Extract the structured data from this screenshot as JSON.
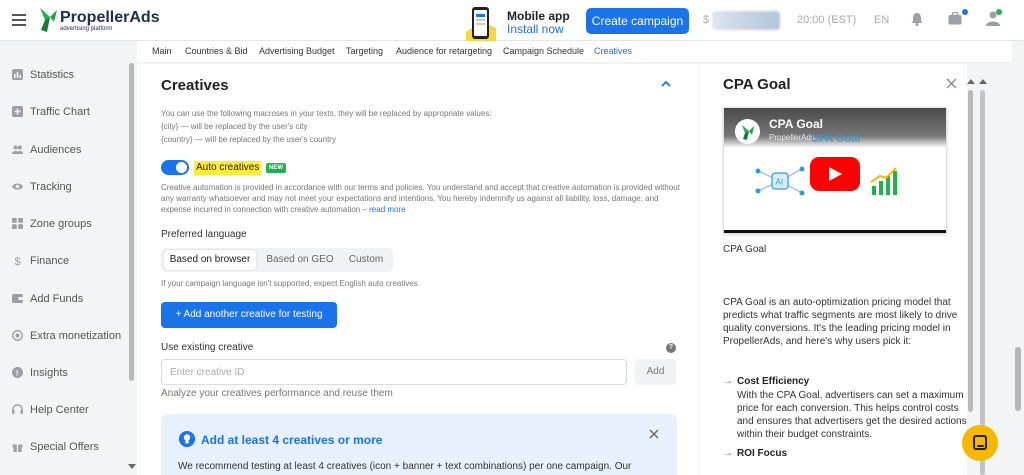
{
  "header": {
    "logo_text": "PropellerAds",
    "logo_tagline": "advertising platform",
    "mobile_app_title": "Mobile app",
    "mobile_app_link": "Install now",
    "create_campaign": "Create campaign",
    "balance_prefix": "$",
    "time": "20:00 (EST)",
    "language": "EN"
  },
  "sidebar": {
    "items": [
      {
        "label": "Statistics",
        "icon": "statistics-icon"
      },
      {
        "label": "Traffic Chart",
        "icon": "traffic-chart-icon"
      },
      {
        "label": "Audiences",
        "icon": "audiences-icon"
      },
      {
        "label": "Tracking",
        "icon": "tracking-icon"
      },
      {
        "label": "Zone groups",
        "icon": "zone-groups-icon"
      },
      {
        "label": "Finance",
        "icon": "dollar-icon"
      },
      {
        "label": "Add Funds",
        "icon": "wallet-icon"
      },
      {
        "label": "Extra monetization",
        "icon": "extra-monetization-icon"
      },
      {
        "label": "Insights",
        "icon": "lightbulb-icon"
      },
      {
        "label": "Help Center",
        "icon": "headset-icon"
      },
      {
        "label": "Special Offers",
        "icon": "gift-icon"
      }
    ]
  },
  "tabs": [
    "Main",
    "Countries & Bid",
    "Advertising Budget",
    "Targeting",
    "Audience for retargeting",
    "Campaign Schedule",
    "Creatives"
  ],
  "active_tab": "Creatives",
  "creatives": {
    "title": "Creatives",
    "macros_intro": "You can use the following macroses in your texts, they will be replaced by appropriate values:",
    "macro_city": "{city} — will be replaced by the user's city",
    "macro_country": "{country} — will be replaced by the user's country",
    "auto_label": "Auto creatives",
    "new_badge": "NEW",
    "auto_enabled": true,
    "disclaimer": "Creative automation is provided in accordance with our terms and policies. You understand and accept that creative automation is provided without any warranty whatsoever and may not meet your expectations and intentions. You hereby indemnify us against all liability, loss, damage, and expense incurred in connection with creative automation – ",
    "read_more": "read more",
    "preferred_language_label": "Preferred language",
    "language_options": [
      "Based on browser",
      "Based on GEO",
      "Custom"
    ],
    "selected_language": "Based on browser",
    "language_hint": "If your campaign language isn't supported, expect English auto creatives.",
    "add_creative_button": "+ Add another creative for testing",
    "existing_label": "Use existing creative",
    "existing_placeholder": "Enter creative ID",
    "existing_value": "",
    "add_button": "Add",
    "analyze_text": "Analyze your creatives performance and reuse them",
    "banner_title": "Add at least 4 creatives or more",
    "banner_text": "We recommend testing at least 4 creatives (icon + banner + text combinations) per one campaign. Our"
  },
  "panel": {
    "title": "CPA Goal",
    "video_title": "CPA Goal",
    "video_channel": "PropellerAds",
    "video_watermark": "CPA Goal",
    "subtitle": "CPA Goal",
    "description": "CPA Goal is an auto-optimization pricing model that predicts what traffic segments are most likely to drive quality conversions. It's the leading pricing model in PropellerAds, and here's why users pick it:",
    "bullets": [
      {
        "title": "Cost Efficiency",
        "text": "With the CPA Goal, advertisers can set a maximum price for each conversion. This helps control costs and ensures that advertisers get the desired actions within their budget constraints."
      },
      {
        "title": "ROI Focus",
        "text": ""
      }
    ]
  },
  "colors": {
    "accent": "#1a73e8",
    "highlight": "#ffeb3b",
    "badge": "#23b14d",
    "chat": "#f5b800"
  }
}
